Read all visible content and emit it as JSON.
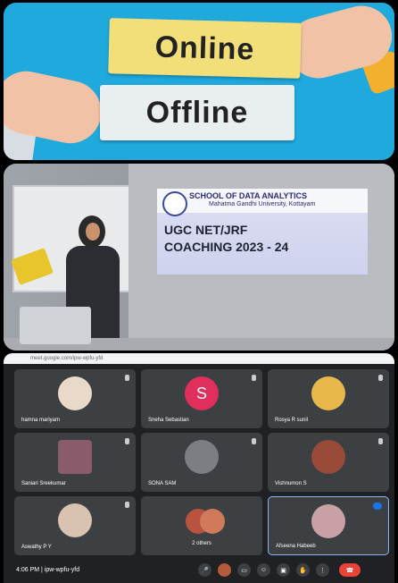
{
  "panel1": {
    "card_top": "Online",
    "card_bottom": "Offline"
  },
  "panel2": {
    "slide_title": "SCHOOL OF DATA ANALYTICS",
    "slide_subtitle": "Mahatma Gandhi University, Kottayam",
    "slide_line1": "UGC NET/JRF",
    "slide_line2": "COACHING  2023 - 24"
  },
  "panel3": {
    "url": "meet.google.com/ipw-wpfu-yfd",
    "participants": [
      {
        "name": "hamna mariyam"
      },
      {
        "name": "Sneha Sebastian",
        "initial": "S"
      },
      {
        "name": "Rosya R sunil"
      },
      {
        "name": "Saniari Sreekumar"
      },
      {
        "name": "SONA SAM"
      },
      {
        "name": "Vishnumon S"
      },
      {
        "name": "Aswathy P Y"
      },
      {
        "name": "2 others"
      },
      {
        "name": "Afseena Habeeb"
      }
    ],
    "time": "4:06 PM",
    "meeting_code": "ipw-wpfu-yfd",
    "controls": [
      "mic-icon",
      "camera-icon",
      "captions-icon",
      "emoji-icon",
      "present-icon",
      "raise-hand-icon",
      "more-icon",
      "end-call-icon"
    ],
    "colors": {
      "background": "#202124",
      "tile": "#3c4043",
      "end_call": "#ea4335",
      "active_border": "#8ab4f8"
    }
  }
}
